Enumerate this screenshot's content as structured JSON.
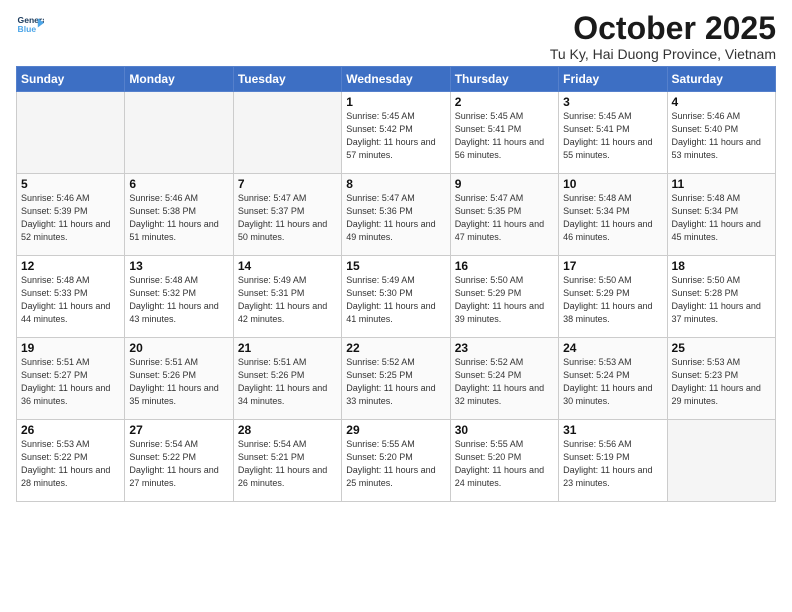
{
  "logo": {
    "line1": "General",
    "line2": "Blue"
  },
  "title": "October 2025",
  "subtitle": "Tu Ky, Hai Duong Province, Vietnam",
  "days_of_week": [
    "Sunday",
    "Monday",
    "Tuesday",
    "Wednesday",
    "Thursday",
    "Friday",
    "Saturday"
  ],
  "weeks": [
    [
      {
        "day": "",
        "empty": true
      },
      {
        "day": "",
        "empty": true
      },
      {
        "day": "",
        "empty": true
      },
      {
        "day": "1",
        "rise": "5:45 AM",
        "set": "5:42 PM",
        "daylight": "11 hours and 57 minutes."
      },
      {
        "day": "2",
        "rise": "5:45 AM",
        "set": "5:41 PM",
        "daylight": "11 hours and 56 minutes."
      },
      {
        "day": "3",
        "rise": "5:45 AM",
        "set": "5:41 PM",
        "daylight": "11 hours and 55 minutes."
      },
      {
        "day": "4",
        "rise": "5:46 AM",
        "set": "5:40 PM",
        "daylight": "11 hours and 53 minutes."
      }
    ],
    [
      {
        "day": "5",
        "rise": "5:46 AM",
        "set": "5:39 PM",
        "daylight": "11 hours and 52 minutes."
      },
      {
        "day": "6",
        "rise": "5:46 AM",
        "set": "5:38 PM",
        "daylight": "11 hours and 51 minutes."
      },
      {
        "day": "7",
        "rise": "5:47 AM",
        "set": "5:37 PM",
        "daylight": "11 hours and 50 minutes."
      },
      {
        "day": "8",
        "rise": "5:47 AM",
        "set": "5:36 PM",
        "daylight": "11 hours and 49 minutes."
      },
      {
        "day": "9",
        "rise": "5:47 AM",
        "set": "5:35 PM",
        "daylight": "11 hours and 47 minutes."
      },
      {
        "day": "10",
        "rise": "5:48 AM",
        "set": "5:34 PM",
        "daylight": "11 hours and 46 minutes."
      },
      {
        "day": "11",
        "rise": "5:48 AM",
        "set": "5:34 PM",
        "daylight": "11 hours and 45 minutes."
      }
    ],
    [
      {
        "day": "12",
        "rise": "5:48 AM",
        "set": "5:33 PM",
        "daylight": "11 hours and 44 minutes."
      },
      {
        "day": "13",
        "rise": "5:48 AM",
        "set": "5:32 PM",
        "daylight": "11 hours and 43 minutes."
      },
      {
        "day": "14",
        "rise": "5:49 AM",
        "set": "5:31 PM",
        "daylight": "11 hours and 42 minutes."
      },
      {
        "day": "15",
        "rise": "5:49 AM",
        "set": "5:30 PM",
        "daylight": "11 hours and 41 minutes."
      },
      {
        "day": "16",
        "rise": "5:50 AM",
        "set": "5:29 PM",
        "daylight": "11 hours and 39 minutes."
      },
      {
        "day": "17",
        "rise": "5:50 AM",
        "set": "5:29 PM",
        "daylight": "11 hours and 38 minutes."
      },
      {
        "day": "18",
        "rise": "5:50 AM",
        "set": "5:28 PM",
        "daylight": "11 hours and 37 minutes."
      }
    ],
    [
      {
        "day": "19",
        "rise": "5:51 AM",
        "set": "5:27 PM",
        "daylight": "11 hours and 36 minutes."
      },
      {
        "day": "20",
        "rise": "5:51 AM",
        "set": "5:26 PM",
        "daylight": "11 hours and 35 minutes."
      },
      {
        "day": "21",
        "rise": "5:51 AM",
        "set": "5:26 PM",
        "daylight": "11 hours and 34 minutes."
      },
      {
        "day": "22",
        "rise": "5:52 AM",
        "set": "5:25 PM",
        "daylight": "11 hours and 33 minutes."
      },
      {
        "day": "23",
        "rise": "5:52 AM",
        "set": "5:24 PM",
        "daylight": "11 hours and 32 minutes."
      },
      {
        "day": "24",
        "rise": "5:53 AM",
        "set": "5:24 PM",
        "daylight": "11 hours and 30 minutes."
      },
      {
        "day": "25",
        "rise": "5:53 AM",
        "set": "5:23 PM",
        "daylight": "11 hours and 29 minutes."
      }
    ],
    [
      {
        "day": "26",
        "rise": "5:53 AM",
        "set": "5:22 PM",
        "daylight": "11 hours and 28 minutes."
      },
      {
        "day": "27",
        "rise": "5:54 AM",
        "set": "5:22 PM",
        "daylight": "11 hours and 27 minutes."
      },
      {
        "day": "28",
        "rise": "5:54 AM",
        "set": "5:21 PM",
        "daylight": "11 hours and 26 minutes."
      },
      {
        "day": "29",
        "rise": "5:55 AM",
        "set": "5:20 PM",
        "daylight": "11 hours and 25 minutes."
      },
      {
        "day": "30",
        "rise": "5:55 AM",
        "set": "5:20 PM",
        "daylight": "11 hours and 24 minutes."
      },
      {
        "day": "31",
        "rise": "5:56 AM",
        "set": "5:19 PM",
        "daylight": "11 hours and 23 minutes."
      },
      {
        "day": "",
        "empty": true
      }
    ]
  ]
}
